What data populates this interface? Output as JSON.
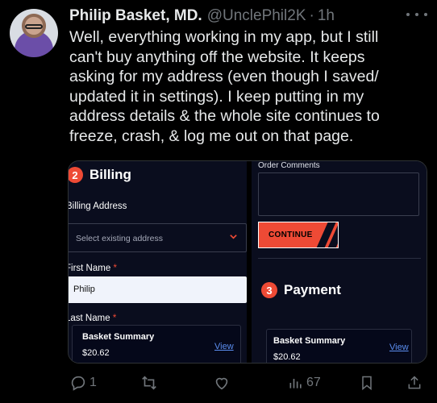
{
  "tweet": {
    "author": {
      "name": "Philip Basket, MD.",
      "handle": "@UnclePhil2K",
      "separator": "·",
      "time": "1h"
    },
    "text_lines": [
      "Well, everything working in my app, but I still",
      "can't buy anything off the website. It keeps",
      "asking for my address (even though I saved/",
      "updated it in settings). I keep putting in my",
      "address details & the whole site continues to",
      "freeze, crash, & log me out on that page."
    ],
    "actions": {
      "replies": "1",
      "retweets": "",
      "likes": "",
      "views": "67"
    }
  },
  "screenshot_left": {
    "step_number": "2",
    "step_title": "Billing",
    "billing_address_label": "Billing Address",
    "select_placeholder": "Select existing address",
    "first_name_label": "First Name",
    "first_name_value": "Philip",
    "last_name_label": "Last Name",
    "required_mark": "*",
    "basket_title": "Basket Summary",
    "basket_price": "$20.62",
    "view_link": "View"
  },
  "screenshot_right": {
    "order_comments_label": "Order Comments",
    "continue_label": "CONTINUE",
    "step_number": "3",
    "step_title": "Payment",
    "basket_title": "Basket Summary",
    "basket_price": "$20.62",
    "view_link": "View"
  },
  "colors": {
    "background": "#000000",
    "accent_red": "#ee4a35",
    "link_blue": "#5b8ef0",
    "muted": "#71767b",
    "panel": "#0a0d1e"
  },
  "icons": [
    "more-icon",
    "reply-icon",
    "retweet-icon",
    "like-icon",
    "views-icon",
    "bookmark-icon",
    "share-icon",
    "chevron-down-icon"
  ]
}
